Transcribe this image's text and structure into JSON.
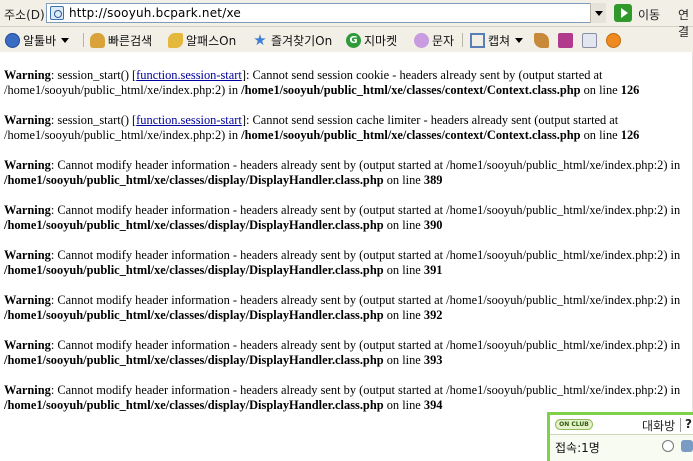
{
  "browser": {
    "address_label": "주소(D)",
    "url": "http://sooyuh.bcpark.net/xe",
    "go_label": "이동",
    "links_label": "연결",
    "toolbar": [
      {
        "label": "알툴바",
        "icon": "altoolbar-icon",
        "has_caret": true
      },
      {
        "label": "빠른검색",
        "icon": "quick-search-icon",
        "has_caret": false
      },
      {
        "label": "알패스On",
        "icon": "key-icon",
        "has_caret": false
      },
      {
        "label": "즐겨찾기On",
        "icon": "star-icon",
        "has_caret": false
      },
      {
        "label": "지마켓",
        "icon": "gmarket-icon",
        "has_caret": false
      },
      {
        "label": "문자",
        "icon": "message-icon",
        "has_caret": false
      },
      {
        "label": "캡쳐",
        "icon": "capture-icon",
        "has_caret": true
      }
    ],
    "toolbar_extra_icons": [
      "broom-icon",
      "save-icon",
      "disk-icon",
      "settings-icon"
    ]
  },
  "warnings": [
    {
      "label": "Warning",
      "pre": ": session_start() [",
      "link": "function.session-start",
      "post": "]: Cannot send session cookie - headers already sent by (output started at /home1/sooyuh/public_html/xe/index.php:2) in ",
      "path": "/home1/sooyuh/public_html/xe/classes/context/Context.class.php",
      "on_line": " on line ",
      "line": "126"
    },
    {
      "label": "Warning",
      "pre": ": session_start() [",
      "link": "function.session-start",
      "post": "]: Cannot send session cache limiter - headers already sent (output started at /home1/sooyuh/public_html/xe/index.php:2) in ",
      "path": "/home1/sooyuh/public_html/xe/classes/context/Context.class.php",
      "on_line": " on line ",
      "line": "126"
    },
    {
      "label": "Warning",
      "pre": ": Cannot modify header information - headers already sent by (output started at /home1/sooyuh/public_html/xe/index.php:2) in ",
      "link": "",
      "post": "",
      "path": "/home1/sooyuh/public_html/xe/classes/display/DisplayHandler.class.php",
      "on_line": " on line ",
      "line": "389"
    },
    {
      "label": "Warning",
      "pre": ": Cannot modify header information - headers already sent by (output started at /home1/sooyuh/public_html/xe/index.php:2) in ",
      "link": "",
      "post": "",
      "path": "/home1/sooyuh/public_html/xe/classes/display/DisplayHandler.class.php",
      "on_line": " on line ",
      "line": "390"
    },
    {
      "label": "Warning",
      "pre": ": Cannot modify header information - headers already sent by (output started at /home1/sooyuh/public_html/xe/index.php:2) in ",
      "link": "",
      "post": "",
      "path": "/home1/sooyuh/public_html/xe/classes/display/DisplayHandler.class.php",
      "on_line": " on line ",
      "line": "391"
    },
    {
      "label": "Warning",
      "pre": ": Cannot modify header information - headers already sent by (output started at /home1/sooyuh/public_html/xe/index.php:2) in ",
      "link": "",
      "post": "",
      "path": "/home1/sooyuh/public_html/xe/classes/display/DisplayHandler.class.php",
      "on_line": " on line ",
      "line": "392"
    },
    {
      "label": "Warning",
      "pre": ": Cannot modify header information - headers already sent by (output started at /home1/sooyuh/public_html/xe/index.php:2) in ",
      "link": "",
      "post": "",
      "path": "/home1/sooyuh/public_html/xe/classes/display/DisplayHandler.class.php",
      "on_line": " on line ",
      "line": "393"
    },
    {
      "label": "Warning",
      "pre": ": Cannot modify header information - headers already sent by (output started at /home1/sooyuh/public_html/xe/index.php:2) in ",
      "link": "",
      "post": "",
      "path": "/home1/sooyuh/public_html/xe/classes/display/DisplayHandler.class.php",
      "on_line": " on line ",
      "line": "394"
    }
  ],
  "widget": {
    "badge": "ON CLUB",
    "tab": "대화방",
    "help": "?",
    "users": "접속:1명"
  },
  "colors": {
    "link": "#00009c",
    "chrome_bg": "#f1efe6",
    "widget_border": "#7fd14a"
  }
}
